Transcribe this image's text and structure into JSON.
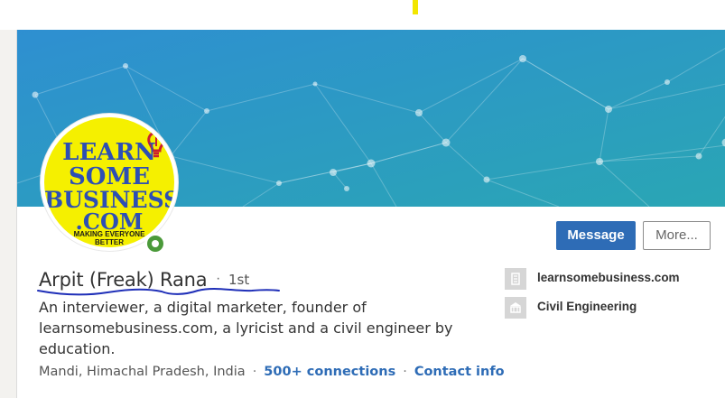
{
  "profile": {
    "name": "Arpit (Freak) Rana",
    "separator": "·",
    "degree": "1st",
    "headline": "An interviewer, a digital marketer, founder of learnsomebusiness.com, a lyricist and a civil engineer by education.",
    "location": "Mandi, Himachal Pradesh, India",
    "connections": "500+ connections",
    "contact_info": "Contact info"
  },
  "avatar_logo": {
    "line1": "LEARN",
    "line2": "SOME",
    "line3": "BUSINESS",
    "line4": ".COM",
    "tagline1": "MAKING EVERYONE",
    "tagline2": "BETTER"
  },
  "actions": {
    "message_label": "Message",
    "more_label": "More..."
  },
  "side_info": {
    "website": "learnsomebusiness.com",
    "education": "Civil Engineering"
  },
  "icons": {
    "website": "building-icon",
    "education": "school-icon",
    "status": "online-status-icon"
  },
  "colors": {
    "banner_start": "#2e8fd1",
    "banner_end": "#2aa6b4",
    "primary": "#2e6cb6",
    "logo_bg": "#f5f000",
    "logo_text": "#2d4fb4",
    "online": "#4b9a3a",
    "annotation_ink": "#1f2fb8"
  }
}
